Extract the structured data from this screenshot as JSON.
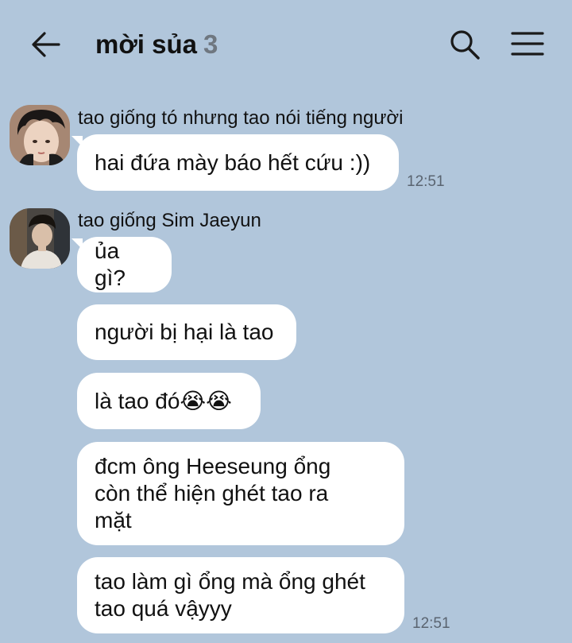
{
  "header": {
    "title": "mời sủa",
    "member_count": "3"
  },
  "groups": [
    {
      "sender": "tao giống tó nhưng tao nói tiếng người",
      "messages": [
        {
          "text": "hai đứa mày báo hết cứu :))"
        }
      ],
      "time": "12:51"
    },
    {
      "sender": "tao giống Sim Jaeyun",
      "messages": [
        {
          "text": "ủa gì?"
        },
        {
          "text": "người bị hại là tao"
        },
        {
          "text": "là tao đó😭😭"
        },
        {
          "text": "đcm ông Heeseung ổng\ncòn thể hiện ghét tao ra\nmặt"
        },
        {
          "text": "tao làm gì ổng mà ổng ghét\ntao quá vậyyy"
        }
      ],
      "time": "12:51"
    }
  ],
  "colors": {
    "background": "#b1c6db",
    "bubble": "#ffffff",
    "text": "#111111",
    "muted": "#6f7780"
  },
  "icons": [
    "back-arrow-icon",
    "search-icon",
    "menu-icon"
  ]
}
